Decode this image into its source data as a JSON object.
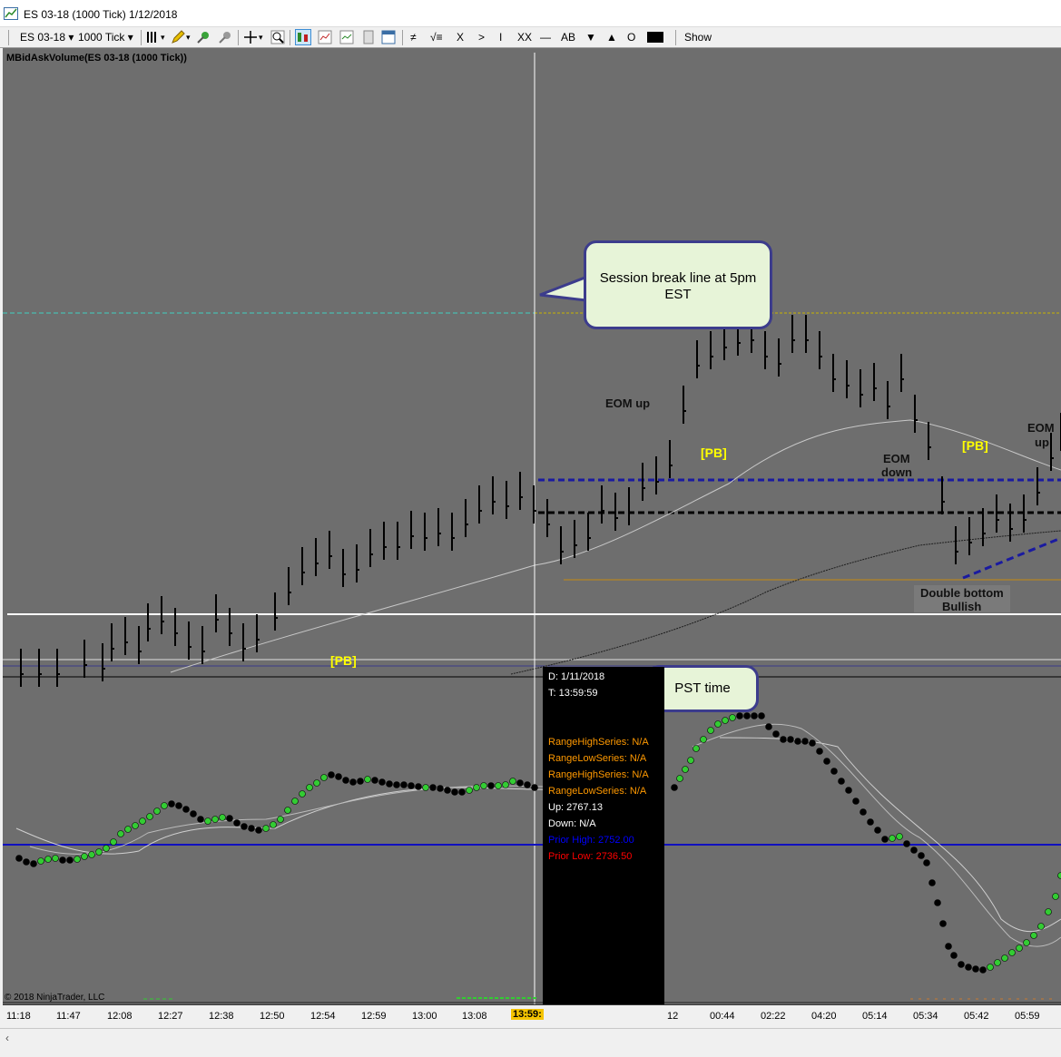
{
  "window": {
    "title": "ES 03-18 (1000 Tick)  1/12/2018"
  },
  "toolbar": {
    "instrument": "ES 03-18",
    "interval": "1000 Tick",
    "tools": [
      "≠",
      "√≡",
      "X",
      ">",
      "I",
      "XX",
      "—",
      "AB",
      "▼",
      "▲",
      "O"
    ],
    "show_label": "Show"
  },
  "chart": {
    "panel_title": "MBidAskVolume(ES 03-18 (1000 Tick))",
    "copyright": "© 2018 NinjaTrader, LLC",
    "annotations": {
      "eom_up_1": "EOM up",
      "pb_1": "[PB]",
      "pb_2": "[PB]",
      "pb_3": "[PB]",
      "eom_down_1": "EOM",
      "eom_down_2": "down",
      "eom_up_2a": "EOM",
      "eom_up_2b": "up",
      "double_bottom_1": "Double bottom",
      "double_bottom_2": "Bullish"
    },
    "callouts": {
      "session_break_1": "Session break line at 5pm",
      "session_break_2": "EST",
      "pst_time": "PST time"
    },
    "tooltip": {
      "date": "D: 1/11/2018",
      "time": "T: 13:59:59",
      "range_high_1": "RangeHighSeries: N/A",
      "range_low_1": "RangeLowSeries: N/A",
      "range_high_2": "RangeHighSeries: N/A",
      "range_low_2": "RangeLowSeries: N/A",
      "up": "Up: 2767.13",
      "down": "Down: N/A",
      "prior_high": "Prior High: 2752.00",
      "prior_low": "Prior Low: 2736.50"
    },
    "x_axis_ticks": [
      "11:18",
      "11:47",
      "12:08",
      "12:27",
      "12:38",
      "12:50",
      "12:54",
      "12:59",
      "13:00",
      "13:08",
      "13:59:",
      "12",
      "00:44",
      "02:22",
      "04:20",
      "05:14",
      "05:34",
      "05:42",
      "05:59"
    ],
    "colors": {
      "background": "#6e6e6e",
      "bars": "#000000",
      "pb_text": "#ffff00",
      "prior_high_text": "#0000ff",
      "prior_low_text": "#ff0000",
      "range_text": "#ff9900",
      "callout_fill": "#e7f4d8",
      "callout_border": "#3c3c8c",
      "oscillator_up": "#33cc33",
      "oscillator_down": "#000000"
    }
  }
}
